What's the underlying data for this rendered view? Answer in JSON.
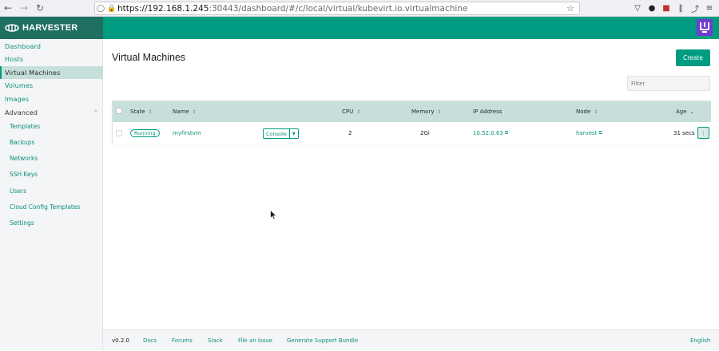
{
  "browser": {
    "url_host": "https://192.168.1.245",
    "url_rest": ":30443/dashboard/#/c/local/virtual/kubevirt.io.virtualmachine"
  },
  "brand": {
    "name": "HARVESTER"
  },
  "sidebar": {
    "items": [
      {
        "label": "Dashboard"
      },
      {
        "label": "Hosts"
      },
      {
        "label": "Virtual Machines"
      },
      {
        "label": "Volumes"
      },
      {
        "label": "Images"
      }
    ],
    "group_label": "Advanced",
    "sub_items": [
      {
        "label": "Templates"
      },
      {
        "label": "Backups"
      },
      {
        "label": "Networks"
      },
      {
        "label": "SSH Keys"
      },
      {
        "label": "Users"
      },
      {
        "label": "Cloud Config Templates"
      },
      {
        "label": "Settings"
      }
    ]
  },
  "main": {
    "title": "Virtual Machines",
    "create_label": "Create",
    "filter_placeholder": "Filter"
  },
  "table": {
    "columns": [
      "State",
      "Name",
      "CPU",
      "Memory",
      "IP Address",
      "Node",
      "Age"
    ],
    "rows": [
      {
        "state": "Running",
        "name": "myfirstvm",
        "console": "Console",
        "cpu": "2",
        "memory": "2Gi",
        "ip": "10.52.0.63",
        "node": "harvest",
        "age": "31 secs"
      }
    ]
  },
  "footer": {
    "version": "v0.2.0",
    "links": [
      "Docs",
      "Forums",
      "Slack",
      "File an Issue",
      "Generate Support Bundle"
    ],
    "language": "English"
  },
  "colors": {
    "primary": "#009c82",
    "brand_bg": "#1f6f61",
    "table_header": "#c7dfdb",
    "avatar": "#6f3bd3"
  }
}
